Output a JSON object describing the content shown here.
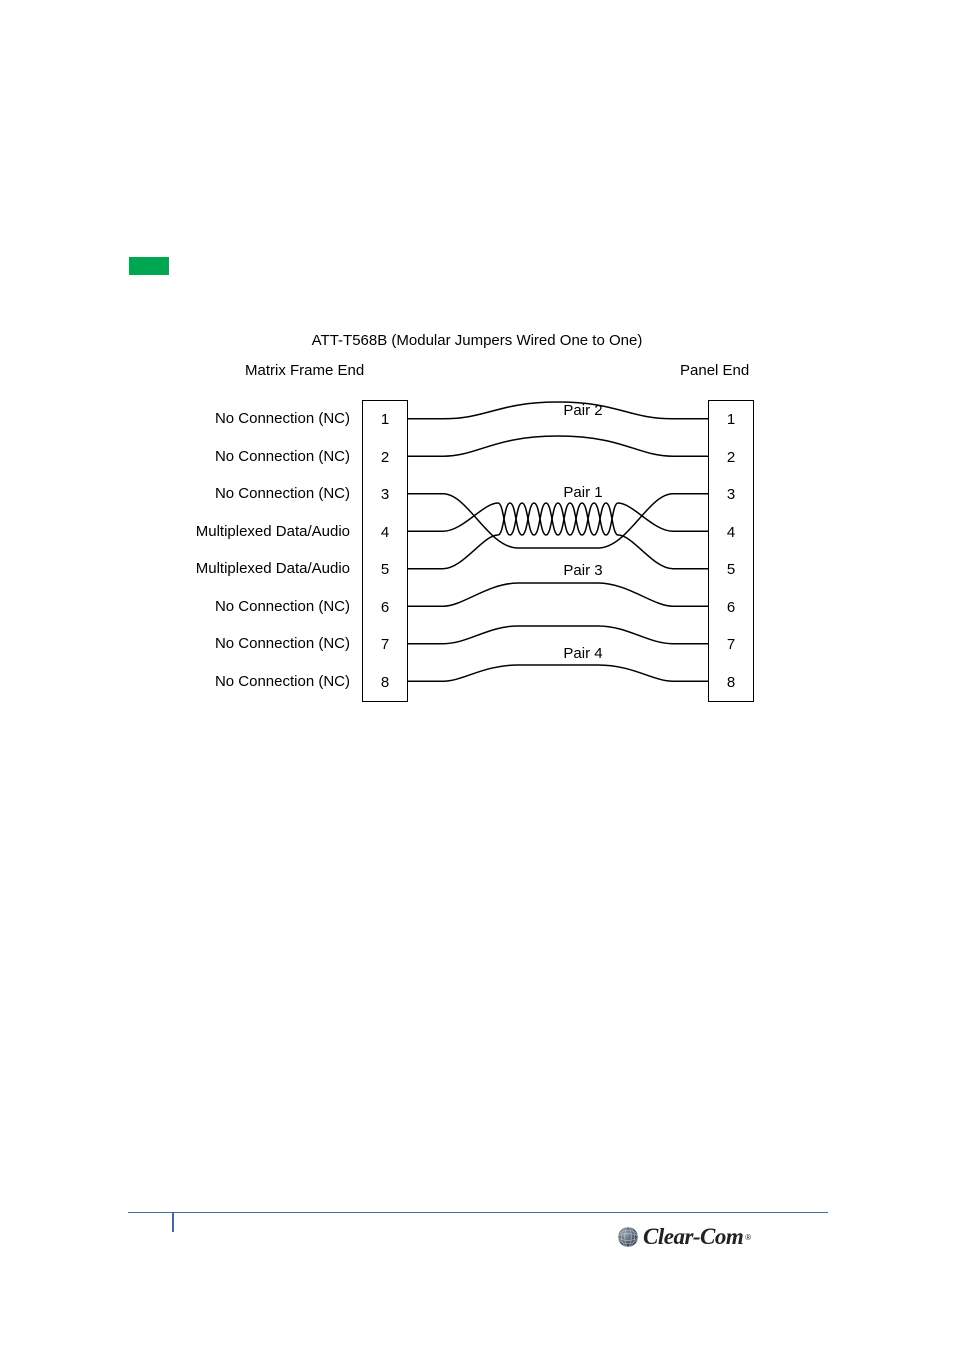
{
  "diagram": {
    "title": "ATT-T568B (Modular Jumpers Wired One to One)",
    "left_end_label": "Matrix Frame End",
    "right_end_label": "Panel End",
    "signals": [
      "No Connection (NC)",
      "No Connection (NC)",
      "No Connection (NC)",
      "Multiplexed Data/Audio",
      "Multiplexed Data/Audio",
      "No Connection (NC)",
      "No Connection (NC)",
      "No Connection (NC)"
    ],
    "pins_left": [
      "1",
      "2",
      "3",
      "4",
      "5",
      "6",
      "7",
      "8"
    ],
    "pins_right": [
      "1",
      "2",
      "3",
      "4",
      "5",
      "6",
      "7",
      "8"
    ],
    "pair_labels": {
      "pair1": "Pair 1",
      "pair2": "Pair 2",
      "pair3": "Pair 3",
      "pair4": "Pair 4"
    }
  },
  "footer": {
    "brand": "Clear-Com",
    "reg": "®"
  }
}
